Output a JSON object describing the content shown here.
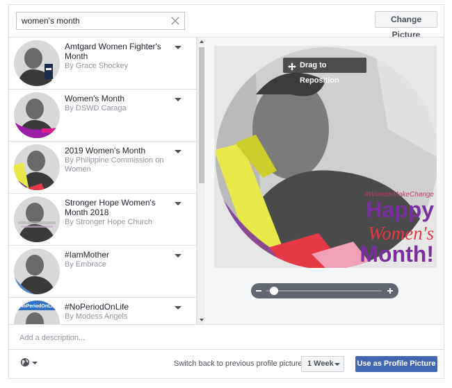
{
  "search": {
    "value": "women's month",
    "clear_icon": "close-icon"
  },
  "header": {
    "change_picture_label": "Change Picture"
  },
  "frames": [
    {
      "title": "Amtgard Women Fighter's Month",
      "byline": "By Grace Shockey"
    },
    {
      "title": "Women's Month",
      "byline": "By DSWD Caraga"
    },
    {
      "title": "2019 Women's Month",
      "byline": "By Philippine Commission on Women"
    },
    {
      "title": "Stronger Hope Women's Month 2018",
      "byline": "By Stronger Hope Church"
    },
    {
      "title": "#IamMother",
      "byline": "By Embrace"
    },
    {
      "title": "#NoPeriodOnLife",
      "byline": "By Modess Angels"
    }
  ],
  "preview": {
    "drag_label": "Drag to Reposition",
    "overlay_hashtag": "#WomenMakeChange",
    "overlay_line1": "Happy",
    "overlay_line2": "Women's",
    "overlay_line3": "Month!",
    "thumb_text_5": "#NoPeriodOnLife",
    "zoom_level": 0.03
  },
  "description": {
    "placeholder": "Add a description..."
  },
  "footer": {
    "switch_back_label": "Switch back to previous profile picture in",
    "duration_value": "1 Week",
    "use_button_label": "Use as Profile Picture"
  },
  "colors": {
    "accent": "#4267b2",
    "overlay_purple": "#7b2f9e",
    "overlay_red": "#e63946",
    "overlay_yellow": "#e8e84a"
  }
}
